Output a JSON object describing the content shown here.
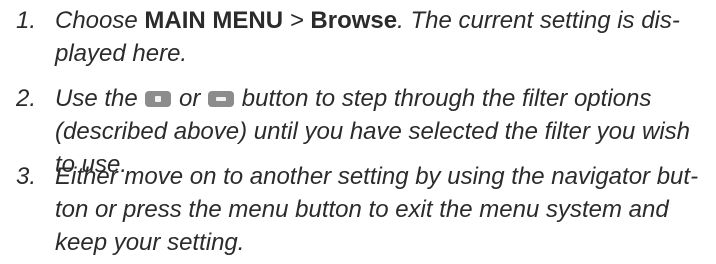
{
  "steps": [
    {
      "number": "1.",
      "l1": {
        "t1": "Choose ",
        "b1": "MAIN MENU",
        "t2": " > ",
        "b2": "Browse",
        "t3": ". The current setting is dis-"
      },
      "l2": "played here."
    },
    {
      "number": "2.",
      "l1": {
        "t1": "Use the ",
        "plus_icon": "plus-button-icon",
        "t2": " or ",
        "minus_icon": "minus-button-icon",
        "t3": " button to step through the filter options"
      },
      "l2": "(described above) until you have selected the filter you wish",
      "l3": "to use."
    },
    {
      "number": "3.",
      "l1": "Either move on to another setting by using the navigator but-",
      "l2": "ton or press the menu button to exit the menu system and",
      "l3": "keep your setting."
    }
  ]
}
